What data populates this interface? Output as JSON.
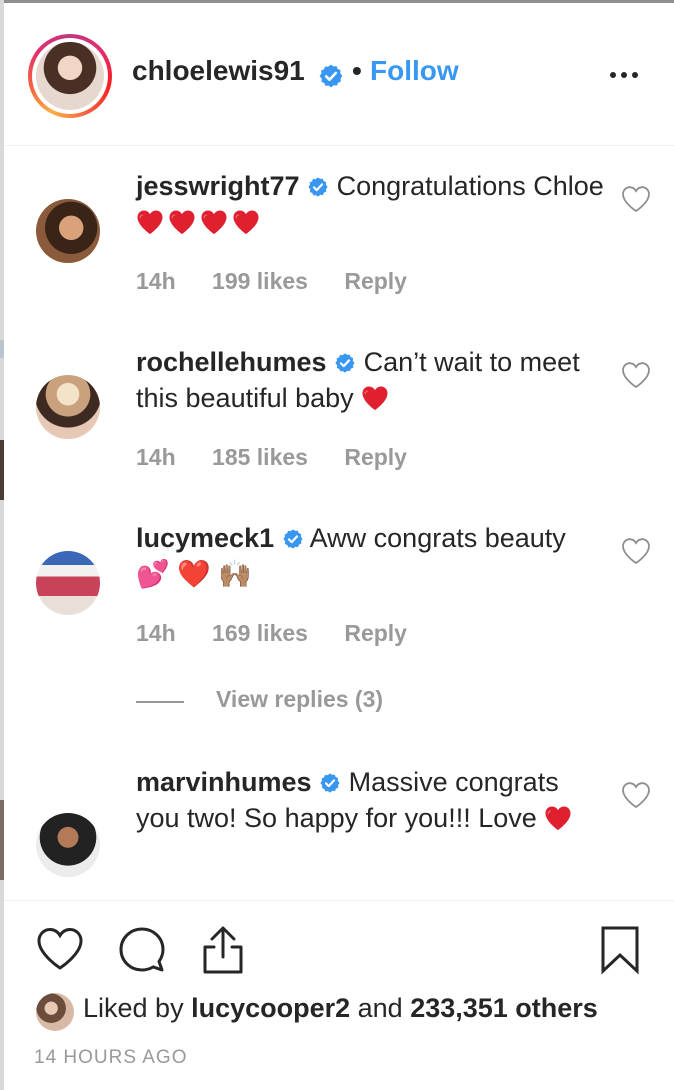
{
  "post": {
    "author": "chloelewis91",
    "separator": "•",
    "follow_label": "Follow"
  },
  "comments": [
    {
      "username": "jesswright77",
      "text": "Congratulations Chloe",
      "hearts": 4,
      "time": "14h",
      "likes": "199 likes",
      "reply": "Reply"
    },
    {
      "username": "rochellehumes",
      "text": "Can’t wait to meet this beautiful baby",
      "hearts": 1,
      "time": "14h",
      "likes": "185 likes",
      "reply": "Reply"
    },
    {
      "username": "lucymeck1",
      "text": "Aww congrats beauty",
      "emoji": "💕 ❤️ 🙌🏽",
      "time": "14h",
      "likes": "169 likes",
      "reply": "Reply"
    },
    {
      "username": "marvinhumes",
      "text": "Massive congrats you two! So happy for you!!! Love",
      "hearts": 1
    }
  ],
  "view_replies": "View replies (3)",
  "likes": {
    "prefix": "Liked by ",
    "user": "lucycooper2",
    "middle": " and ",
    "count": "233,351 others"
  },
  "timestamp": "14 HOURS AGO",
  "icons": {
    "verified": "verified-badge-icon",
    "like": "heart-outline-icon",
    "comment": "comment-bubble-icon",
    "share": "share-upload-icon",
    "save": "bookmark-icon",
    "more": "more-options-icon"
  },
  "colors": {
    "accent": "#3897f0",
    "text": "#262626",
    "muted": "#999999",
    "emoji_heart": "#e0202e",
    "verified": "#3897f0"
  }
}
